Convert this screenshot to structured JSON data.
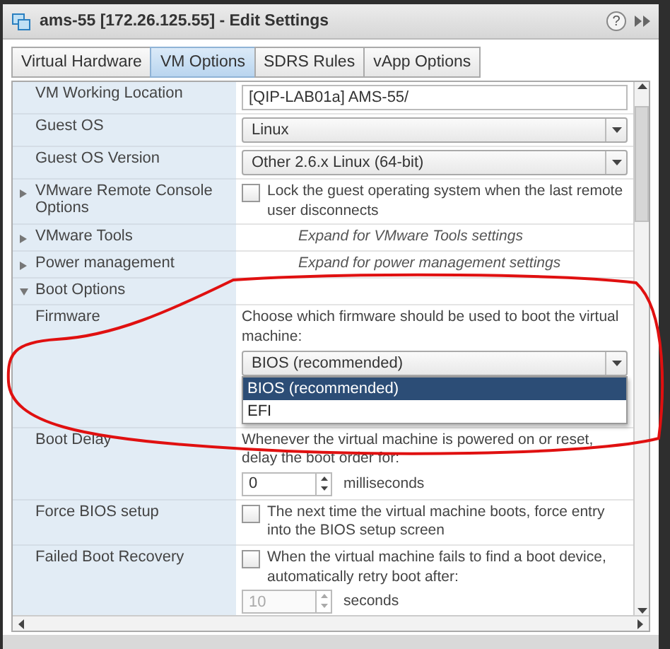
{
  "window": {
    "title": "ams-55 [172.26.125.55] - Edit Settings",
    "help": "?"
  },
  "tabs": [
    {
      "label": "Virtual Hardware",
      "selected": false
    },
    {
      "label": "VM Options",
      "selected": true
    },
    {
      "label": "SDRS Rules",
      "selected": false
    },
    {
      "label": "vApp Options",
      "selected": false
    }
  ],
  "rows": [
    {
      "label": "VM Working Location",
      "controls": [
        {
          "kind": "text-field",
          "value": "[QIP-LAB01a] AMS-55/"
        }
      ]
    },
    {
      "label": "Guest OS",
      "controls": [
        {
          "kind": "select",
          "value": "Linux"
        }
      ]
    },
    {
      "label": "Guest OS Version",
      "controls": [
        {
          "kind": "select",
          "value": "Other 2.6.x Linux (64-bit)"
        }
      ]
    },
    {
      "label": "VMware Remote Console Options",
      "expanded": false,
      "controls": [
        {
          "kind": "checkbox",
          "checked": false,
          "disabled": false,
          "text": "Lock the guest operating system when the last remote user disconnects"
        }
      ]
    },
    {
      "label": "VMware Tools",
      "expanded": false,
      "controls": [
        {
          "kind": "hint",
          "text": "Expand for VMware Tools settings"
        }
      ]
    },
    {
      "label": "Power management",
      "expanded": false,
      "controls": [
        {
          "kind": "hint",
          "text": "Expand for power management settings"
        }
      ]
    },
    {
      "label": "Boot Options",
      "expanded": true,
      "controls": []
    },
    {
      "label": "Firmware",
      "controls": [
        {
          "kind": "description",
          "text": "Choose which firmware should be used to boot the virtual machine:"
        },
        {
          "kind": "select",
          "value": "BIOS (recommended)",
          "options": [
            {
              "label": "BIOS (recommended)",
              "selected": true
            },
            {
              "label": "EFI",
              "selected": false
            }
          ]
        }
      ]
    },
    {
      "label": "Boot Delay",
      "controls": [
        {
          "kind": "description",
          "text": "Whenever the virtual machine is powered on or reset, delay the boot order for:"
        },
        {
          "kind": "spinner",
          "value": "0",
          "unit": "milliseconds",
          "disabled": false
        }
      ]
    },
    {
      "label": "Force BIOS setup",
      "controls": [
        {
          "kind": "checkbox",
          "checked": false,
          "disabled": false,
          "text": "The next time the virtual machine boots, force entry into the BIOS setup screen"
        }
      ]
    },
    {
      "label": "Failed Boot Recovery",
      "controls": [
        {
          "kind": "checkbox",
          "checked": false,
          "disabled": false,
          "text": "When the virtual machine fails to find a boot device, automatically retry boot after:"
        },
        {
          "kind": "spinner",
          "value": "10",
          "unit": "seconds",
          "disabled": true
        }
      ]
    }
  ]
}
